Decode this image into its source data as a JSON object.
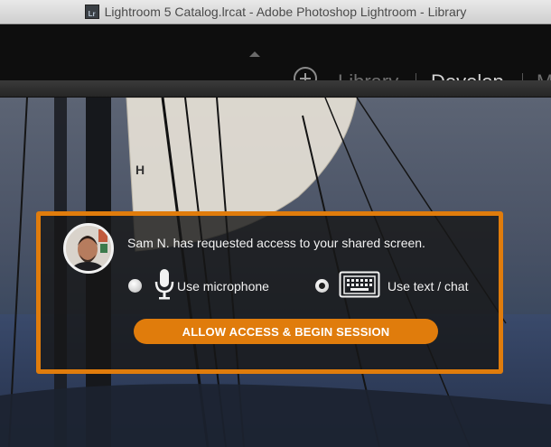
{
  "window": {
    "app_icon_text": "Lr",
    "title": "Lightroom 5 Catalog.lrcat - Adobe Photoshop Lightroom - Library"
  },
  "modules": {
    "library": "Library",
    "develop": "Develop",
    "map_partial": "M"
  },
  "dialog": {
    "message": "Sam N. has requested access to your shared screen.",
    "options": [
      {
        "label": "Use microphone",
        "selected": false,
        "icon": "microphone-icon"
      },
      {
        "label": "Use text / chat",
        "selected": true,
        "icon": "keyboard-icon"
      }
    ],
    "allow_button": "ALLOW ACCESS & BEGIN SESSION"
  },
  "colors": {
    "accent": "#e07c0c",
    "module_active": "#d2d2d2",
    "module_inactive": "#6e6e6e"
  }
}
